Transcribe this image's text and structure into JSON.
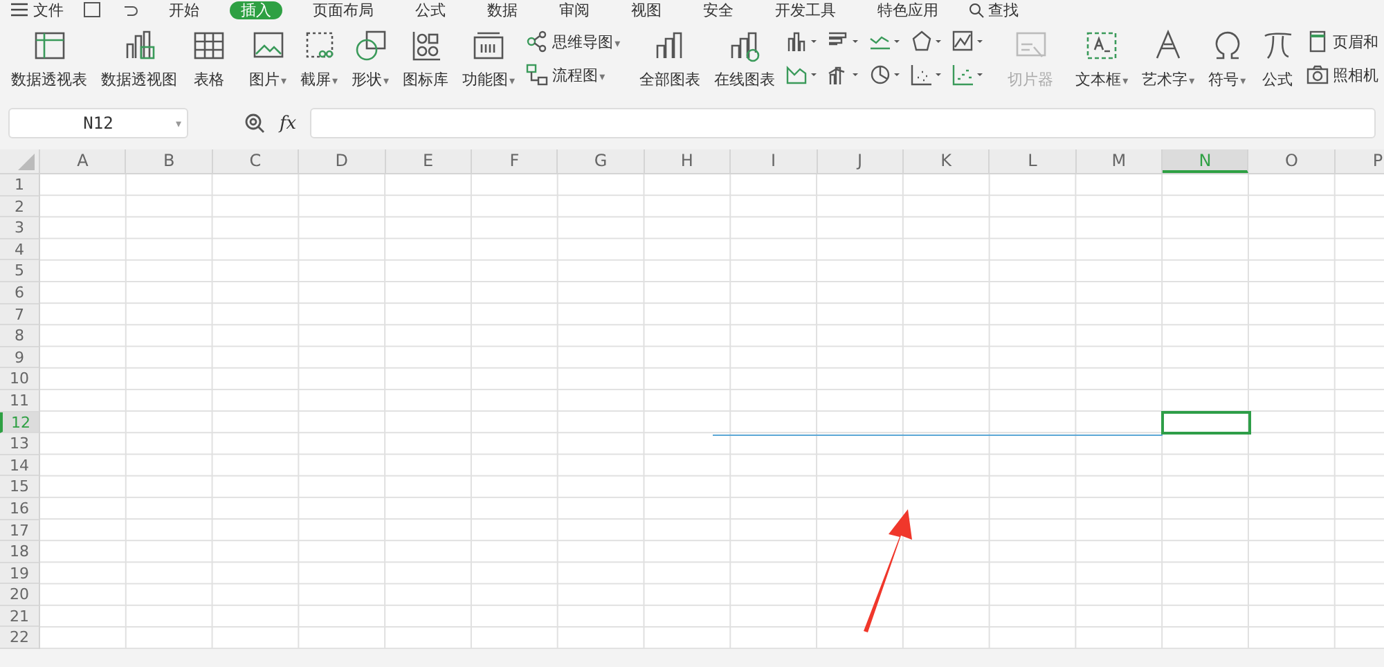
{
  "menu": {
    "file_label": "文件",
    "tabs": [
      {
        "label": "开始",
        "selected": false
      },
      {
        "label": "插入",
        "selected": true
      },
      {
        "label": "页面布局",
        "selected": false
      },
      {
        "label": "公式",
        "selected": false
      },
      {
        "label": "数据",
        "selected": false
      },
      {
        "label": "审阅",
        "selected": false
      },
      {
        "label": "视图",
        "selected": false
      },
      {
        "label": "安全",
        "selected": false
      },
      {
        "label": "开发工具",
        "selected": false
      },
      {
        "label": "特色应用",
        "selected": false
      }
    ],
    "search_label": "查找"
  },
  "ribbon": [
    {
      "kind": "large",
      "label": "数据透视表",
      "disabled": false
    },
    {
      "kind": "large",
      "label": "数据透视图",
      "disabled": false
    },
    {
      "kind": "large",
      "label": "表格",
      "disabled": false
    },
    {
      "kind": "sep"
    },
    {
      "kind": "large",
      "label": "图片",
      "caret": "▾",
      "disabled": false
    },
    {
      "kind": "large",
      "label": "截屏",
      "caret": "▾",
      "disabled": false
    },
    {
      "kind": "large",
      "label": "形状",
      "caret": "▾",
      "disabled": false
    },
    {
      "kind": "large",
      "label": "图标库",
      "disabled": false
    },
    {
      "kind": "large",
      "label": "功能图",
      "caret": "▾",
      "disabled": false
    },
    {
      "kind": "pair",
      "items": [
        {
          "label": "思维导图",
          "caret": "▾"
        },
        {
          "label": "流程图",
          "caret": "▾"
        }
      ]
    },
    {
      "kind": "sep"
    },
    {
      "kind": "large",
      "label": "全部图表",
      "disabled": false
    },
    {
      "kind": "large",
      "label": "在线图表",
      "disabled": false
    },
    {
      "kind": "chartgrid"
    },
    {
      "kind": "sep"
    },
    {
      "kind": "large",
      "label": "切片器",
      "disabled": true
    },
    {
      "kind": "sep"
    },
    {
      "kind": "large",
      "label": "文本框",
      "caret": "▾",
      "disabled": false
    },
    {
      "kind": "large",
      "label": "艺术字",
      "caret": "▾",
      "disabled": false
    },
    {
      "kind": "large",
      "label": "符号",
      "caret": "▾",
      "disabled": false
    },
    {
      "kind": "large",
      "label": "公式",
      "disabled": false
    },
    {
      "kind": "pair",
      "items": [
        {
          "label": "页眉和"
        },
        {
          "label": "照相机"
        }
      ]
    }
  ],
  "formula_bar": {
    "name_box": "N12",
    "name_box_caret": "▾",
    "fx_label": "fx"
  },
  "sheet": {
    "columns": [
      {
        "label": "A",
        "selected": false
      },
      {
        "label": "B",
        "selected": false
      },
      {
        "label": "C",
        "selected": false
      },
      {
        "label": "D",
        "selected": false
      },
      {
        "label": "E",
        "selected": false
      },
      {
        "label": "F",
        "selected": false
      },
      {
        "label": "G",
        "selected": false
      },
      {
        "label": "H",
        "selected": false
      },
      {
        "label": "I",
        "selected": false
      },
      {
        "label": "J",
        "selected": false
      },
      {
        "label": "K",
        "selected": false
      },
      {
        "label": "L",
        "selected": false
      },
      {
        "label": "M",
        "selected": false
      },
      {
        "label": "N",
        "selected": true
      },
      {
        "label": "O",
        "selected": false
      },
      {
        "label": "P",
        "selected": false
      }
    ],
    "rows": [
      {
        "label": "1",
        "selected": false
      },
      {
        "label": "2",
        "selected": false
      },
      {
        "label": "3",
        "selected": false
      },
      {
        "label": "4",
        "selected": false
      },
      {
        "label": "5",
        "selected": false
      },
      {
        "label": "6",
        "selected": false
      },
      {
        "label": "7",
        "selected": false
      },
      {
        "label": "8",
        "selected": false
      },
      {
        "label": "9",
        "selected": false
      },
      {
        "label": "10",
        "selected": false
      },
      {
        "label": "11",
        "selected": false
      },
      {
        "label": "12",
        "selected": true
      },
      {
        "label": "13",
        "selected": false
      },
      {
        "label": "14",
        "selected": false
      },
      {
        "label": "15",
        "selected": false
      },
      {
        "label": "16",
        "selected": false
      },
      {
        "label": "17",
        "selected": false
      },
      {
        "label": "18",
        "selected": false
      },
      {
        "label": "19",
        "selected": false
      },
      {
        "label": "20",
        "selected": false
      },
      {
        "label": "21",
        "selected": false
      },
      {
        "label": "22",
        "selected": false
      }
    ]
  }
}
